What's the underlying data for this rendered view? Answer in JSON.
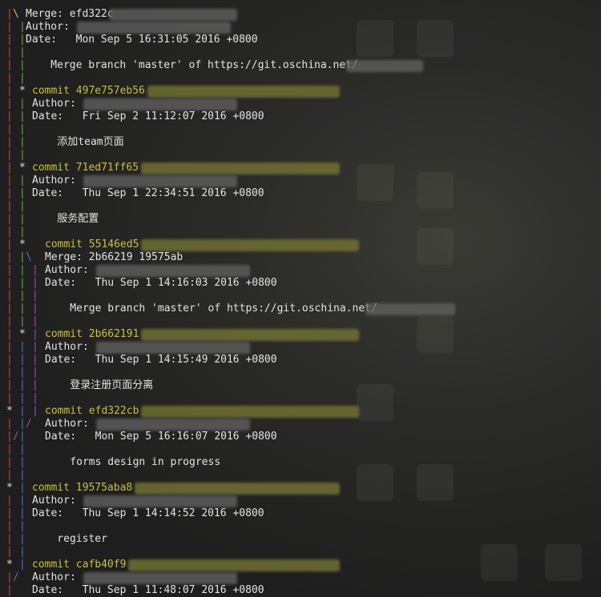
{
  "terminal": {
    "lines": [
      {
        "graph": [
          {
            "ch": "|",
            "col": 0,
            "c": "red"
          },
          {
            "ch": "\\",
            "col": 1,
            "c": "yellow"
          }
        ],
        "text": "Merge: efd322c",
        "col": 3,
        "kind": "merge",
        "blur": {
          "col": 16,
          "len": 20,
          "c": "w"
        }
      },
      {
        "graph": [
          {
            "ch": "|",
            "col": 0,
            "c": "red"
          },
          {
            "ch": "|",
            "col": 2,
            "c": "green"
          }
        ],
        "text": "Author:",
        "col": 3,
        "kind": "author",
        "blur": {
          "col": 11,
          "len": 24,
          "c": "w"
        }
      },
      {
        "graph": [
          {
            "ch": "|",
            "col": 0,
            "c": "red"
          },
          {
            "ch": "|",
            "col": 2,
            "c": "green"
          }
        ],
        "text": "Date:   Mon Sep 5 16:31:05 2016 +0800",
        "col": 3,
        "kind": "date"
      },
      {
        "graph": [
          {
            "ch": "|",
            "col": 0,
            "c": "red"
          },
          {
            "ch": "|",
            "col": 2,
            "c": "green"
          }
        ],
        "text": "",
        "col": 3,
        "kind": "blank"
      },
      {
        "graph": [
          {
            "ch": "|",
            "col": 0,
            "c": "red"
          },
          {
            "ch": "|",
            "col": 2,
            "c": "green"
          }
        ],
        "text": "    Merge branch 'master' of https://git.oschina.net/",
        "col": 3,
        "kind": "message",
        "blur": {
          "col": 53,
          "len": 12,
          "c": "w"
        }
      },
      {
        "graph": [
          {
            "ch": "|",
            "col": 0,
            "c": "red"
          },
          {
            "ch": "|",
            "col": 2,
            "c": "green"
          }
        ],
        "text": "",
        "col": 3,
        "kind": "blank"
      },
      {
        "graph": [
          {
            "ch": "|",
            "col": 0,
            "c": "red"
          },
          {
            "ch": "*",
            "col": 2,
            "c": "star"
          }
        ],
        "text": "commit 497e757eb56",
        "col": 4,
        "kind": "commit",
        "blur": {
          "col": 22,
          "len": 30,
          "c": "y"
        }
      },
      {
        "graph": [
          {
            "ch": "|",
            "col": 0,
            "c": "red"
          },
          {
            "ch": "|",
            "col": 2,
            "c": "green"
          }
        ],
        "text": "Author:",
        "col": 4,
        "kind": "author",
        "blur": {
          "col": 12,
          "len": 24,
          "c": "w"
        }
      },
      {
        "graph": [
          {
            "ch": "|",
            "col": 0,
            "c": "red"
          },
          {
            "ch": "|",
            "col": 2,
            "c": "green"
          }
        ],
        "text": "Date:   Fri Sep 2 11:12:07 2016 +0800",
        "col": 4,
        "kind": "date"
      },
      {
        "graph": [
          {
            "ch": "|",
            "col": 0,
            "c": "red"
          },
          {
            "ch": "|",
            "col": 2,
            "c": "green"
          }
        ],
        "text": "",
        "col": 4,
        "kind": "blank"
      },
      {
        "graph": [
          {
            "ch": "|",
            "col": 0,
            "c": "red"
          },
          {
            "ch": "|",
            "col": 2,
            "c": "green"
          }
        ],
        "text": "    添加team页面",
        "col": 4,
        "kind": "message"
      },
      {
        "graph": [
          {
            "ch": "|",
            "col": 0,
            "c": "red"
          },
          {
            "ch": "|",
            "col": 2,
            "c": "green"
          }
        ],
        "text": "",
        "col": 4,
        "kind": "blank"
      },
      {
        "graph": [
          {
            "ch": "|",
            "col": 0,
            "c": "red"
          },
          {
            "ch": "*",
            "col": 2,
            "c": "star"
          }
        ],
        "text": "commit 71ed71ff65",
        "col": 4,
        "kind": "commit",
        "blur": {
          "col": 21,
          "len": 31,
          "c": "y"
        }
      },
      {
        "graph": [
          {
            "ch": "|",
            "col": 0,
            "c": "red"
          },
          {
            "ch": "|",
            "col": 2,
            "c": "green"
          }
        ],
        "text": "Author:",
        "col": 4,
        "kind": "author",
        "blur": {
          "col": 12,
          "len": 24,
          "c": "w"
        }
      },
      {
        "graph": [
          {
            "ch": "|",
            "col": 0,
            "c": "red"
          },
          {
            "ch": "|",
            "col": 2,
            "c": "green"
          }
        ],
        "text": "Date:   Thu Sep 1 22:34:51 2016 +0800",
        "col": 4,
        "kind": "date"
      },
      {
        "graph": [
          {
            "ch": "|",
            "col": 0,
            "c": "red"
          },
          {
            "ch": "|",
            "col": 2,
            "c": "green"
          }
        ],
        "text": "",
        "col": 4,
        "kind": "blank"
      },
      {
        "graph": [
          {
            "ch": "|",
            "col": 0,
            "c": "red"
          },
          {
            "ch": "|",
            "col": 2,
            "c": "green"
          }
        ],
        "text": "    服务配置",
        "col": 4,
        "kind": "message"
      },
      {
        "graph": [
          {
            "ch": "|",
            "col": 0,
            "c": "red"
          },
          {
            "ch": "|",
            "col": 2,
            "c": "green"
          }
        ],
        "text": "",
        "col": 4,
        "kind": "blank"
      },
      {
        "graph": [
          {
            "ch": "|",
            "col": 0,
            "c": "red"
          },
          {
            "ch": "*",
            "col": 2,
            "c": "star"
          }
        ],
        "text": "commit 55146ed5",
        "col": 6,
        "kind": "commit",
        "blur": {
          "col": 21,
          "len": 34,
          "c": "y"
        }
      },
      {
        "graph": [
          {
            "ch": "|",
            "col": 0,
            "c": "red"
          },
          {
            "ch": "|",
            "col": 2,
            "c": "green"
          },
          {
            "ch": "\\",
            "col": 3,
            "c": "blue"
          }
        ],
        "text": "Merge: 2b66219 19575ab",
        "col": 6,
        "kind": "merge"
      },
      {
        "graph": [
          {
            "ch": "|",
            "col": 0,
            "c": "red"
          },
          {
            "ch": "|",
            "col": 2,
            "c": "green"
          },
          {
            "ch": "|",
            "col": 4,
            "c": "magenta"
          }
        ],
        "text": "Author:",
        "col": 6,
        "kind": "author",
        "blur": {
          "col": 14,
          "len": 24,
          "c": "w"
        }
      },
      {
        "graph": [
          {
            "ch": "|",
            "col": 0,
            "c": "red"
          },
          {
            "ch": "|",
            "col": 2,
            "c": "green"
          },
          {
            "ch": "|",
            "col": 4,
            "c": "magenta"
          }
        ],
        "text": "Date:   Thu Sep 1 14:16:03 2016 +0800",
        "col": 6,
        "kind": "date"
      },
      {
        "graph": [
          {
            "ch": "|",
            "col": 0,
            "c": "red"
          },
          {
            "ch": "|",
            "col": 2,
            "c": "green"
          },
          {
            "ch": "|",
            "col": 4,
            "c": "magenta"
          }
        ],
        "text": "",
        "col": 6,
        "kind": "blank"
      },
      {
        "graph": [
          {
            "ch": "|",
            "col": 0,
            "c": "red"
          },
          {
            "ch": "|",
            "col": 2,
            "c": "green"
          },
          {
            "ch": "|",
            "col": 4,
            "c": "magenta"
          }
        ],
        "text": "    Merge branch 'master' of https://git.oschina.net/",
        "col": 6,
        "kind": "message",
        "blur": {
          "col": 56,
          "len": 14,
          "c": "w"
        }
      },
      {
        "graph": [
          {
            "ch": "|",
            "col": 0,
            "c": "red"
          },
          {
            "ch": "|",
            "col": 2,
            "c": "green"
          },
          {
            "ch": "|",
            "col": 4,
            "c": "magenta"
          }
        ],
        "text": "",
        "col": 6,
        "kind": "blank"
      },
      {
        "graph": [
          {
            "ch": "|",
            "col": 0,
            "c": "red"
          },
          {
            "ch": "*",
            "col": 2,
            "c": "star"
          },
          {
            "ch": "|",
            "col": 4,
            "c": "magenta"
          }
        ],
        "text": "commit 2b662191",
        "col": 6,
        "kind": "commit",
        "blur": {
          "col": 21,
          "len": 34,
          "c": "y"
        }
      },
      {
        "graph": [
          {
            "ch": "|",
            "col": 0,
            "c": "red"
          },
          {
            "ch": "|",
            "col": 2,
            "c": "blue"
          },
          {
            "ch": "|",
            "col": 4,
            "c": "magenta"
          }
        ],
        "text": "Author:",
        "col": 6,
        "kind": "author",
        "blur": {
          "col": 14,
          "len": 24,
          "c": "w"
        }
      },
      {
        "graph": [
          {
            "ch": "|",
            "col": 0,
            "c": "red"
          },
          {
            "ch": "|",
            "col": 2,
            "c": "blue"
          },
          {
            "ch": "|",
            "col": 4,
            "c": "magenta"
          }
        ],
        "text": "Date:   Thu Sep 1 14:15:49 2016 +0800",
        "col": 6,
        "kind": "date"
      },
      {
        "graph": [
          {
            "ch": "|",
            "col": 0,
            "c": "red"
          },
          {
            "ch": "|",
            "col": 2,
            "c": "blue"
          },
          {
            "ch": "|",
            "col": 4,
            "c": "magenta"
          }
        ],
        "text": "",
        "col": 6,
        "kind": "blank"
      },
      {
        "graph": [
          {
            "ch": "|",
            "col": 0,
            "c": "red"
          },
          {
            "ch": "|",
            "col": 2,
            "c": "blue"
          },
          {
            "ch": "|",
            "col": 4,
            "c": "magenta"
          }
        ],
        "text": "    登录注册页面分离",
        "col": 6,
        "kind": "message"
      },
      {
        "graph": [
          {
            "ch": "|",
            "col": 0,
            "c": "red"
          },
          {
            "ch": "|",
            "col": 2,
            "c": "blue"
          },
          {
            "ch": "|",
            "col": 4,
            "c": "magenta"
          }
        ],
        "text": "",
        "col": 6,
        "kind": "blank"
      },
      {
        "graph": [
          {
            "ch": "*",
            "col": 0,
            "c": "star"
          },
          {
            "ch": "|",
            "col": 2,
            "c": "blue"
          },
          {
            "ch": "|",
            "col": 4,
            "c": "magenta"
          }
        ],
        "text": "commit efd322cb",
        "col": 6,
        "kind": "commit",
        "blur": {
          "col": 21,
          "len": 34,
          "c": "y"
        }
      },
      {
        "graph": [
          {
            "ch": "|",
            "col": 0,
            "c": "red"
          },
          {
            "ch": "|",
            "col": 2,
            "c": "blue"
          },
          {
            "ch": "/",
            "col": 3,
            "c": "magenta"
          }
        ],
        "text": "Author:",
        "col": 6,
        "kind": "author",
        "blur": {
          "col": 14,
          "len": 24,
          "c": "w"
        }
      },
      {
        "graph": [
          {
            "ch": "|",
            "col": 0,
            "c": "red"
          },
          {
            "ch": "/",
            "col": 1,
            "c": "magenta"
          },
          {
            "ch": "|",
            "col": 2,
            "c": "blue"
          }
        ],
        "text": "Date:   Mon Sep 5 16:16:07 2016 +0800",
        "col": 6,
        "kind": "date"
      },
      {
        "graph": [
          {
            "ch": "|",
            "col": 0,
            "c": "red"
          },
          {
            "ch": "|",
            "col": 2,
            "c": "blue"
          }
        ],
        "text": "",
        "col": 6,
        "kind": "blank"
      },
      {
        "graph": [
          {
            "ch": "|",
            "col": 0,
            "c": "red"
          },
          {
            "ch": "|",
            "col": 2,
            "c": "blue"
          }
        ],
        "text": "    forms design in progress",
        "col": 6,
        "kind": "message"
      },
      {
        "graph": [
          {
            "ch": "|",
            "col": 0,
            "c": "red"
          },
          {
            "ch": "|",
            "col": 2,
            "c": "blue"
          }
        ],
        "text": "",
        "col": 6,
        "kind": "blank"
      },
      {
        "graph": [
          {
            "ch": "*",
            "col": 0,
            "c": "star"
          },
          {
            "ch": "|",
            "col": 2,
            "c": "blue"
          }
        ],
        "text": "commit 19575aba8",
        "col": 4,
        "kind": "commit",
        "blur": {
          "col": 20,
          "len": 32,
          "c": "y"
        }
      },
      {
        "graph": [
          {
            "ch": "|",
            "col": 0,
            "c": "red"
          },
          {
            "ch": "|",
            "col": 2,
            "c": "blue"
          }
        ],
        "text": "Author:",
        "col": 4,
        "kind": "author",
        "blur": {
          "col": 12,
          "len": 24,
          "c": "w"
        }
      },
      {
        "graph": [
          {
            "ch": "|",
            "col": 0,
            "c": "red"
          },
          {
            "ch": "|",
            "col": 2,
            "c": "blue"
          }
        ],
        "text": "Date:   Thu Sep 1 14:14:52 2016 +0800",
        "col": 4,
        "kind": "date"
      },
      {
        "graph": [
          {
            "ch": "|",
            "col": 0,
            "c": "red"
          },
          {
            "ch": "|",
            "col": 2,
            "c": "blue"
          }
        ],
        "text": "",
        "col": 4,
        "kind": "blank"
      },
      {
        "graph": [
          {
            "ch": "|",
            "col": 0,
            "c": "red"
          },
          {
            "ch": "|",
            "col": 2,
            "c": "blue"
          }
        ],
        "text": "    register",
        "col": 4,
        "kind": "message"
      },
      {
        "graph": [
          {
            "ch": "|",
            "col": 0,
            "c": "red"
          },
          {
            "ch": "|",
            "col": 2,
            "c": "blue"
          }
        ],
        "text": "",
        "col": 4,
        "kind": "blank"
      },
      {
        "graph": [
          {
            "ch": "*",
            "col": 0,
            "c": "star"
          },
          {
            "ch": "|",
            "col": 2,
            "c": "blue"
          }
        ],
        "text": "commit cafb40f9",
        "col": 4,
        "kind": "commit",
        "blur": {
          "col": 19,
          "len": 33,
          "c": "y"
        }
      },
      {
        "graph": [
          {
            "ch": "|",
            "col": 0,
            "c": "red"
          },
          {
            "ch": "/",
            "col": 1,
            "c": "blue"
          }
        ],
        "text": "Author:",
        "col": 4,
        "kind": "author",
        "blur": {
          "col": 12,
          "len": 24,
          "c": "w"
        }
      },
      {
        "graph": [
          {
            "ch": "|",
            "col": 0,
            "c": "red"
          }
        ],
        "text": "Date:   Thu Sep 1 11:48:07 2016 +0800",
        "col": 4,
        "kind": "date"
      }
    ]
  },
  "colors": {
    "background": "#232323",
    "text": "#e3e3e3",
    "commit_hash": "#c9c23c",
    "graph_red": "#c64848",
    "graph_green": "#5cae46",
    "graph_blue": "#4f78c8",
    "graph_magenta": "#a14cb4"
  }
}
